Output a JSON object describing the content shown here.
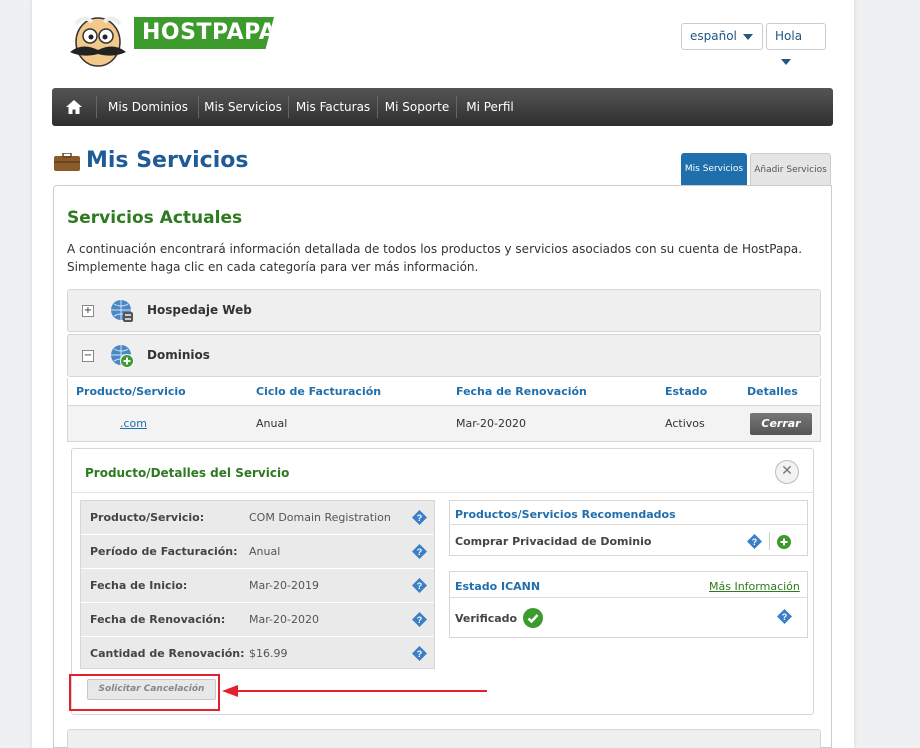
{
  "header": {
    "logo_text": "HOSTPAPA",
    "language": "español",
    "greeting": "Hola"
  },
  "nav": {
    "items": [
      "Mis Dominios",
      "Mis Servicios",
      "Mis Facturas",
      "Mi Soporte",
      "Mi Perfil"
    ]
  },
  "page": {
    "title": "Mis Servicios",
    "tabs": [
      "Mis Servicios",
      "Añadir Servicios"
    ]
  },
  "services": {
    "section_title": "Servicios Actuales",
    "intro": "A continuación encontrará información detallada de todos los productos y servicios asociados con su cuenta de HostPapa. Simplemente haga clic en cada categoría para ver más información.",
    "categories": [
      {
        "label": "Hospedaje Web",
        "toggle": "+"
      },
      {
        "label": "Dominios",
        "toggle": "−"
      }
    ],
    "columns": [
      "Producto/Servicio",
      "Ciclo de Facturación",
      "Fecha de Renovación",
      "Estado",
      "Detalles"
    ],
    "row": {
      "product": ".com",
      "cycle": "Anual",
      "renewal": "Mar-20-2020",
      "status": "Activos",
      "action": "Cerrar"
    }
  },
  "details": {
    "title": "Producto/Detalles del Servicio",
    "rows": [
      {
        "label": "Producto/Servicio:",
        "value": "COM Domain Registration"
      },
      {
        "label": "Período de Facturación:",
        "value": "Anual"
      },
      {
        "label": "Fecha de Inicio:",
        "value": "Mar-20-2019"
      },
      {
        "label": "Fecha de Renovación:",
        "value": "Mar-20-2020"
      },
      {
        "label": "Cantidad de Renovación:",
        "value": "$16.99"
      }
    ],
    "recommended_title": "Productos/Servicios Recomendados",
    "recommended_item": "Comprar Privacidad de Dominio",
    "icann_title": "Estado ICANN",
    "icann_link": "Más Información",
    "icann_status": "Verificado",
    "cancel_label": "Solicitar Cancelación"
  },
  "colors": {
    "brand_green": "#3d9a2d",
    "link_blue": "#1f6fad",
    "title_blue": "#1f5b96",
    "annotation_red": "#e3202b"
  }
}
